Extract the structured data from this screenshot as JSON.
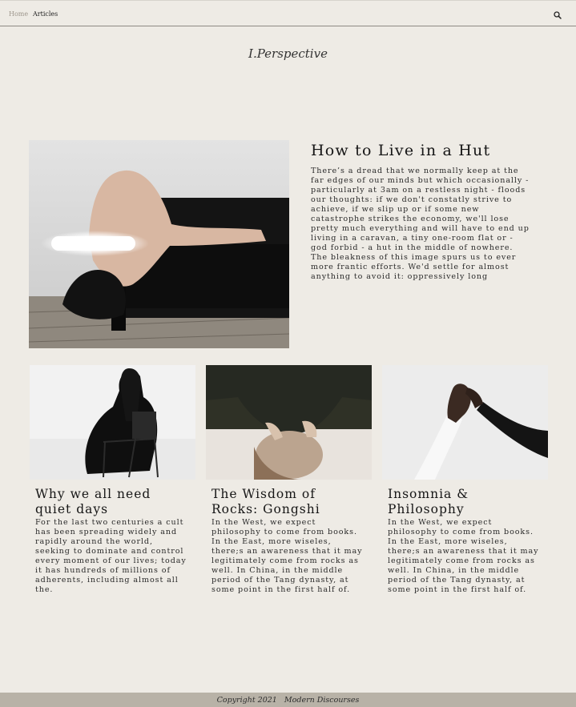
{
  "nav": {
    "home_label": "Home",
    "articles_label": "Articles",
    "search_icon": "search-icon"
  },
  "site": {
    "title": "I.Perspective"
  },
  "feature": {
    "title": "How to Live in a Hut",
    "text": "There’s a dread that we normally keep at the far edges of our minds but which occasionally - particularly at 3am on a restless night - floods our thoughts: if we don't constatly strive to achieve, if we slip up or if some new catastrophe strikes the economy, we'll lose pretty much everything and will have to end up living in a caravan, a tiny one-room flat or - god forbid - a hut in the middle of nowhere. The bleakness of this image spurs us to ever more frantic efforts. We'd settle for almost anything to avoid it: oppressively long"
  },
  "cards": [
    {
      "title": "Why we all need quiet days",
      "text": "For the last two centuries a cult has been spreading widely and rapidly around the world, seeking to dominate and control every moment of our lives; today it has hundreds of millions of adherents, including almost all the."
    },
    {
      "title": "The Wisdom of Rocks: Gongshi",
      "text": "In the West, we expect philosophy to come from books. In the East, more wiseles, there;s an awareness that it may legitimately come from rocks as well. In China, in the middle period of the Tang dynasty, at some point in the first half of."
    },
    {
      "title": "Insomnia & Philosophy",
      "text": "In the West, we expect philosophy to come from books. In the East, more wiseles, there;s an awareness that it may legitimately come from rocks as well. In China, in the middle period of the Tang dynasty, at some point in the first half of."
    }
  ],
  "footer": {
    "text": "Copyright 2021   Modern Discourses"
  },
  "colors": {
    "background": "#eeebe5",
    "footer_bar": "#b8b2a7",
    "muted_nav": "#9c958b"
  }
}
